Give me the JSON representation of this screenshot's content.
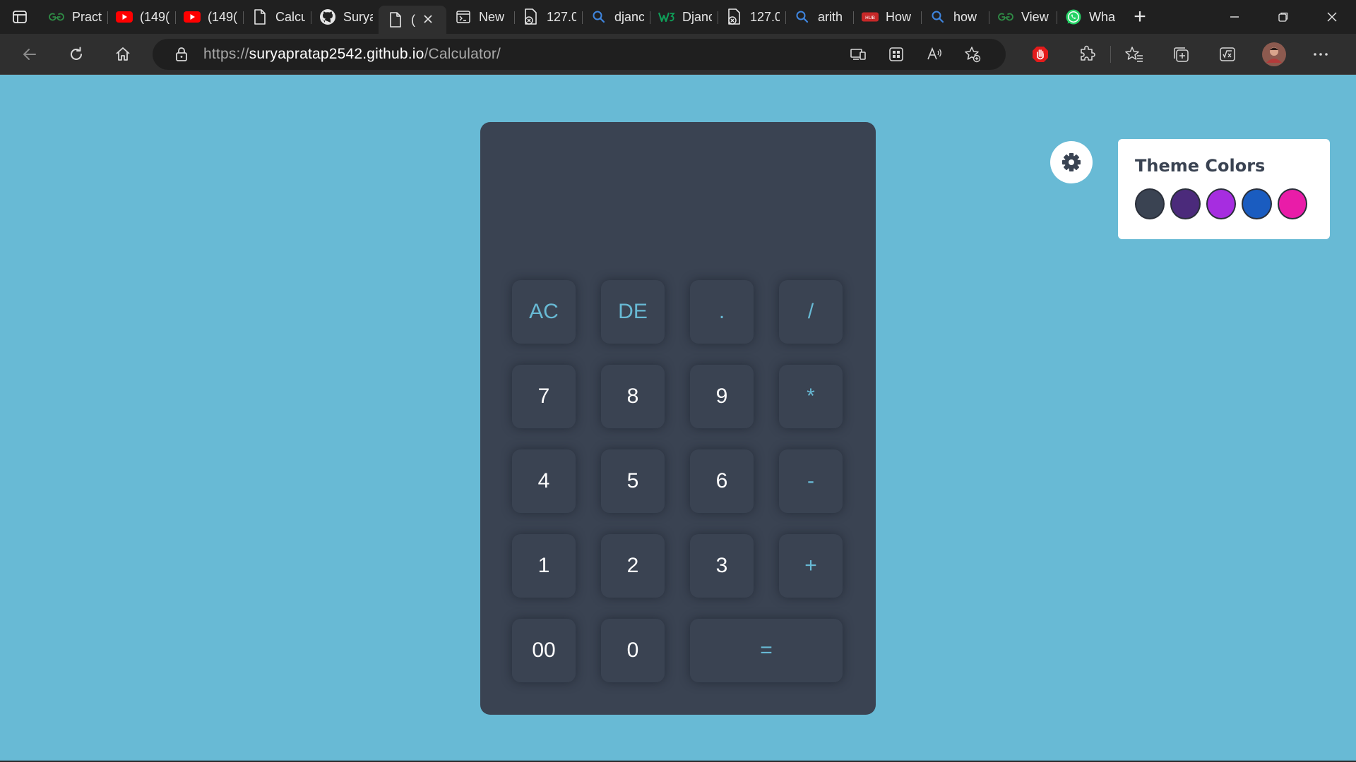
{
  "browser": {
    "tabs": [
      {
        "title": "Pract",
        "icon": "gfg-icon",
        "active": false
      },
      {
        "title": "(149(",
        "icon": "youtube-icon",
        "active": false
      },
      {
        "title": "(149(",
        "icon": "youtube-icon",
        "active": false
      },
      {
        "title": "Calcu",
        "icon": "page-icon",
        "active": false
      },
      {
        "title": "Surya",
        "icon": "github-icon",
        "active": false
      },
      {
        "title": "(",
        "icon": "page-icon",
        "active": true
      },
      {
        "title": "New",
        "icon": "newtab-icon",
        "active": false
      },
      {
        "title": "127.0",
        "icon": "error-page-icon",
        "active": false
      },
      {
        "title": "djanc",
        "icon": "search-icon",
        "active": false
      },
      {
        "title": "Djanc",
        "icon": "w3-icon",
        "active": false
      },
      {
        "title": "127.0",
        "icon": "error-page-icon",
        "active": false
      },
      {
        "title": "arith",
        "icon": "search-icon",
        "active": false
      },
      {
        "title": "How",
        "icon": "hub-icon",
        "active": false
      },
      {
        "title": "how",
        "icon": "search-icon",
        "active": false
      },
      {
        "title": "View",
        "icon": "gfg-icon",
        "active": false
      },
      {
        "title": "Wha",
        "icon": "whatsapp-icon",
        "active": false
      }
    ],
    "url_prefix": "https://",
    "url_host": "suryapratap2542.github.io",
    "url_path": "/Calculator/"
  },
  "calculator": {
    "display": "",
    "keys": [
      {
        "label": "AC",
        "type": "op"
      },
      {
        "label": "DE",
        "type": "op"
      },
      {
        "label": ".",
        "type": "op"
      },
      {
        "label": "/",
        "type": "op"
      },
      {
        "label": "7",
        "type": "num"
      },
      {
        "label": "8",
        "type": "num"
      },
      {
        "label": "9",
        "type": "num"
      },
      {
        "label": "*",
        "type": "op"
      },
      {
        "label": "4",
        "type": "num"
      },
      {
        "label": "5",
        "type": "num"
      },
      {
        "label": "6",
        "type": "num"
      },
      {
        "label": "-",
        "type": "op"
      },
      {
        "label": "1",
        "type": "num"
      },
      {
        "label": "2",
        "type": "num"
      },
      {
        "label": "3",
        "type": "num"
      },
      {
        "label": "+",
        "type": "op"
      },
      {
        "label": "00",
        "type": "num"
      },
      {
        "label": "0",
        "type": "num"
      },
      {
        "label": "=",
        "type": "op"
      }
    ]
  },
  "theme": {
    "title": "Theme Colors",
    "colors": [
      "#3a4352",
      "#4b2a7b",
      "#a62de0",
      "#1a5cc0",
      "#e91ca8"
    ]
  },
  "colors": {
    "page_bg": "#68bad5",
    "calc_bg": "#3a4352",
    "accent": "#68bad5"
  }
}
